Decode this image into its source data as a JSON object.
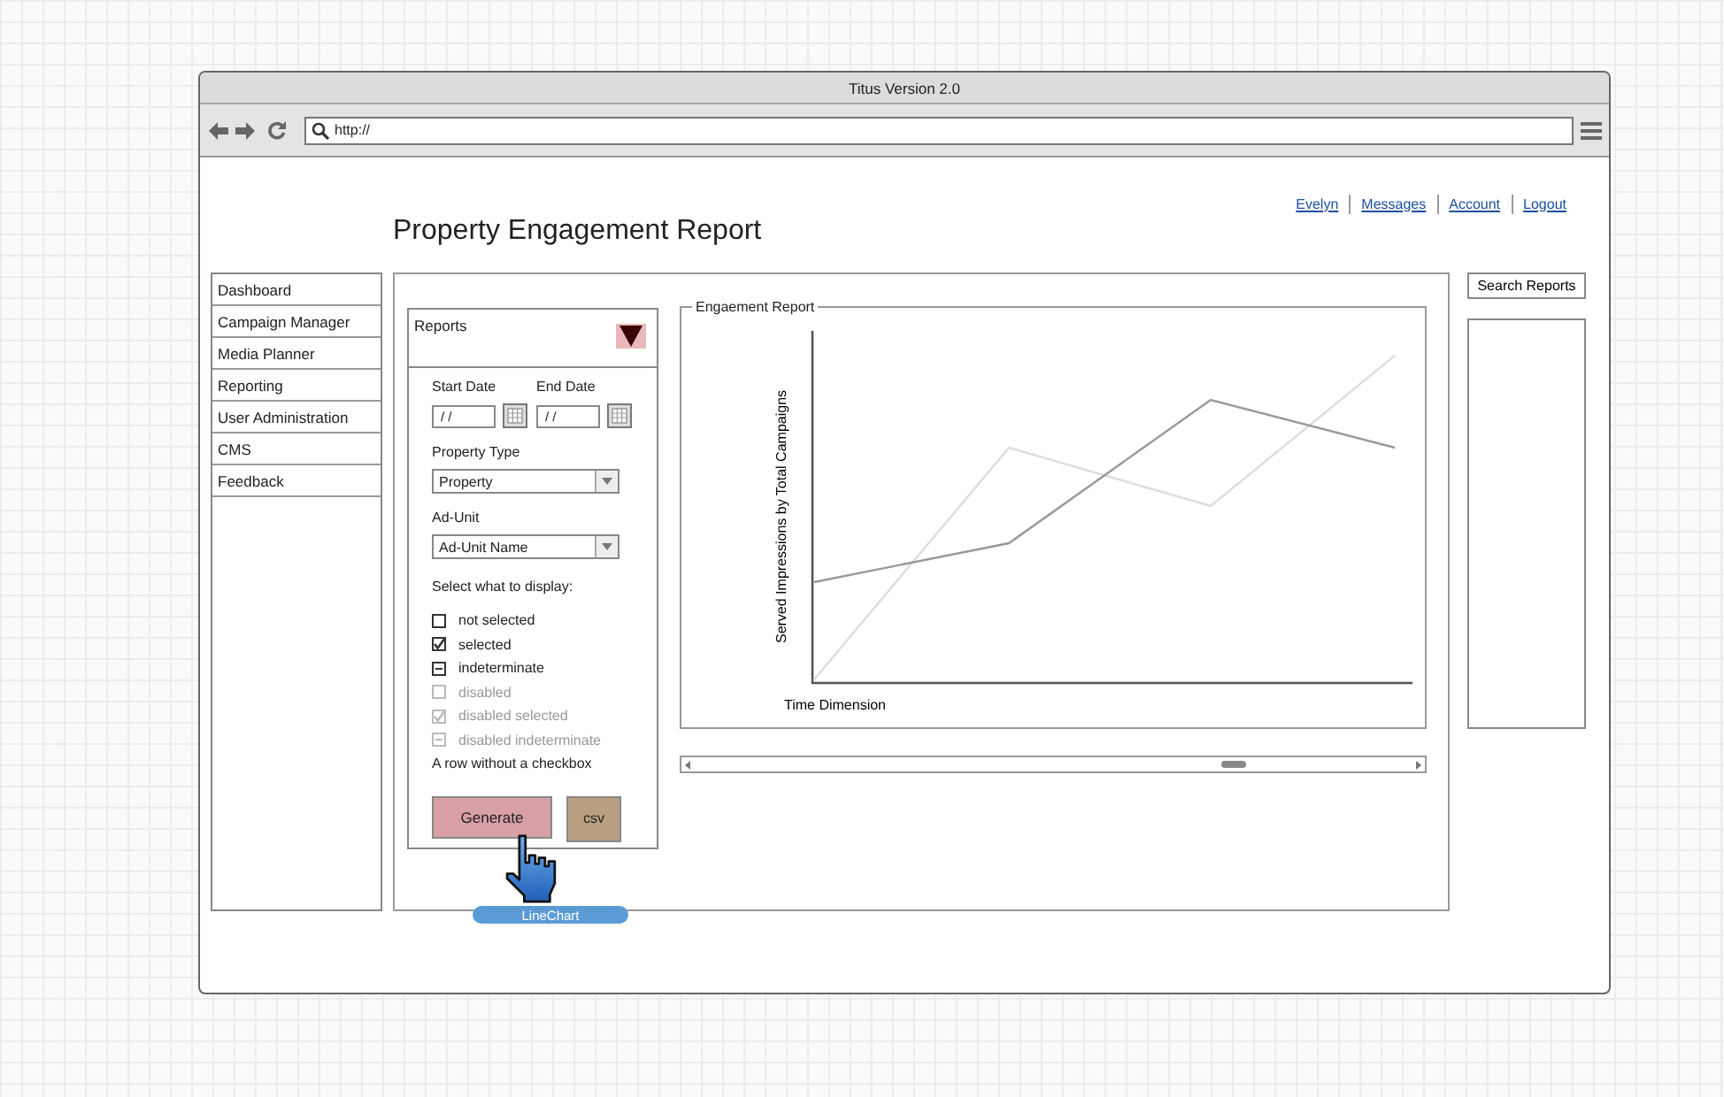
{
  "window": {
    "title": "Titus Version 2.0"
  },
  "browser": {
    "url": "http://"
  },
  "user_links": [
    "Evelyn",
    "Messages",
    "Account",
    "Logout"
  ],
  "page_title": "Property Engagement Report",
  "sidebar": {
    "items": [
      "Dashboard",
      "Campaign Manager",
      "Media Planner",
      "Reporting",
      "User Administration",
      "CMS",
      "Feedback"
    ]
  },
  "reports_panel": {
    "title": "Reports",
    "start_date": {
      "label": "Start Date",
      "value": "/ /"
    },
    "end_date": {
      "label": "End Date",
      "value": "/ /"
    },
    "property_type": {
      "label": "Property Type",
      "value": "Property"
    },
    "ad_unit": {
      "label": "Ad-Unit",
      "value": "Ad-Unit Name"
    },
    "display_label": "Select what to display:",
    "options": [
      {
        "kind": "checkbox",
        "label": "not selected",
        "checked": false,
        "indeterminate": false,
        "disabled": false
      },
      {
        "kind": "checkbox",
        "label": "selected",
        "checked": true,
        "indeterminate": false,
        "disabled": false
      },
      {
        "kind": "checkbox",
        "label": "indeterminate",
        "checked": false,
        "indeterminate": true,
        "disabled": false
      },
      {
        "kind": "checkbox",
        "label": "disabled",
        "checked": false,
        "indeterminate": false,
        "disabled": true
      },
      {
        "kind": "checkbox",
        "label": "disabled selected",
        "checked": true,
        "indeterminate": false,
        "disabled": true
      },
      {
        "kind": "checkbox",
        "label": "disabled indeterminate",
        "checked": false,
        "indeterminate": true,
        "disabled": true
      },
      {
        "kind": "plain",
        "label": "A row without a checkbox"
      }
    ],
    "buttons": [
      {
        "label": "Generate",
        "kind": "primary"
      },
      {
        "label": "csv",
        "kind": "secondary"
      }
    ]
  },
  "chart": {
    "title": "Engaement Report",
    "ylabel": "Served Impressions by Total Campaigns",
    "xlabel": "Time Dimension"
  },
  "search_button": "Search Reports",
  "component_label": "LineChart"
}
